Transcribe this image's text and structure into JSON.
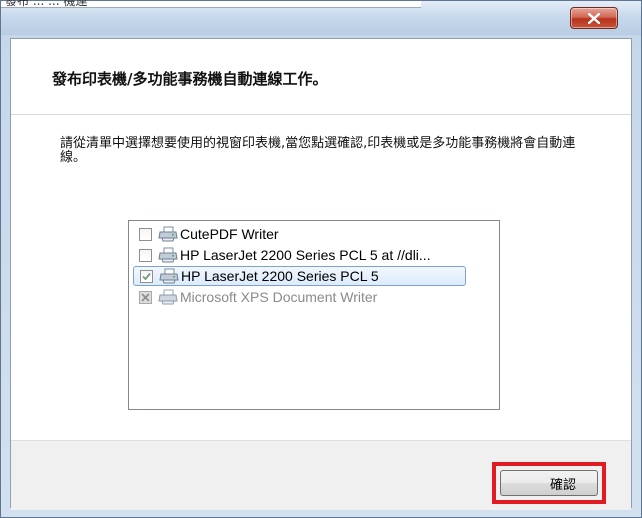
{
  "titlebar": {
    "partial_text": "發布 ...  ... 機連"
  },
  "header": {
    "title": "發布印表機/多功能事務機自動連線工作。"
  },
  "instructions": {
    "text": "請從清單中選擇想要使用的視窗印表機,當您點選確認,印表機或是多功能事務機將會自動連線。"
  },
  "printers": [
    {
      "label": "CutePDF Writer",
      "checked": false,
      "disabled": false,
      "selected": false,
      "icon": "printer-icon"
    },
    {
      "label": "HP LaserJet 2200 Series PCL 5 at //dli...",
      "checked": false,
      "disabled": false,
      "selected": false,
      "icon": "printer-icon"
    },
    {
      "label": "HP LaserJet 2200 Series PCL 5",
      "checked": true,
      "disabled": false,
      "selected": true,
      "icon": "printer-icon"
    },
    {
      "label": "Microsoft XPS Document Writer",
      "checked": true,
      "disabled": true,
      "selected": false,
      "icon": "printer-icon"
    }
  ],
  "footer": {
    "ok_label": "確認"
  },
  "colors": {
    "highlight_border": "#e01b22",
    "close_button": "#c8553b",
    "selection": "#dcebfc"
  }
}
